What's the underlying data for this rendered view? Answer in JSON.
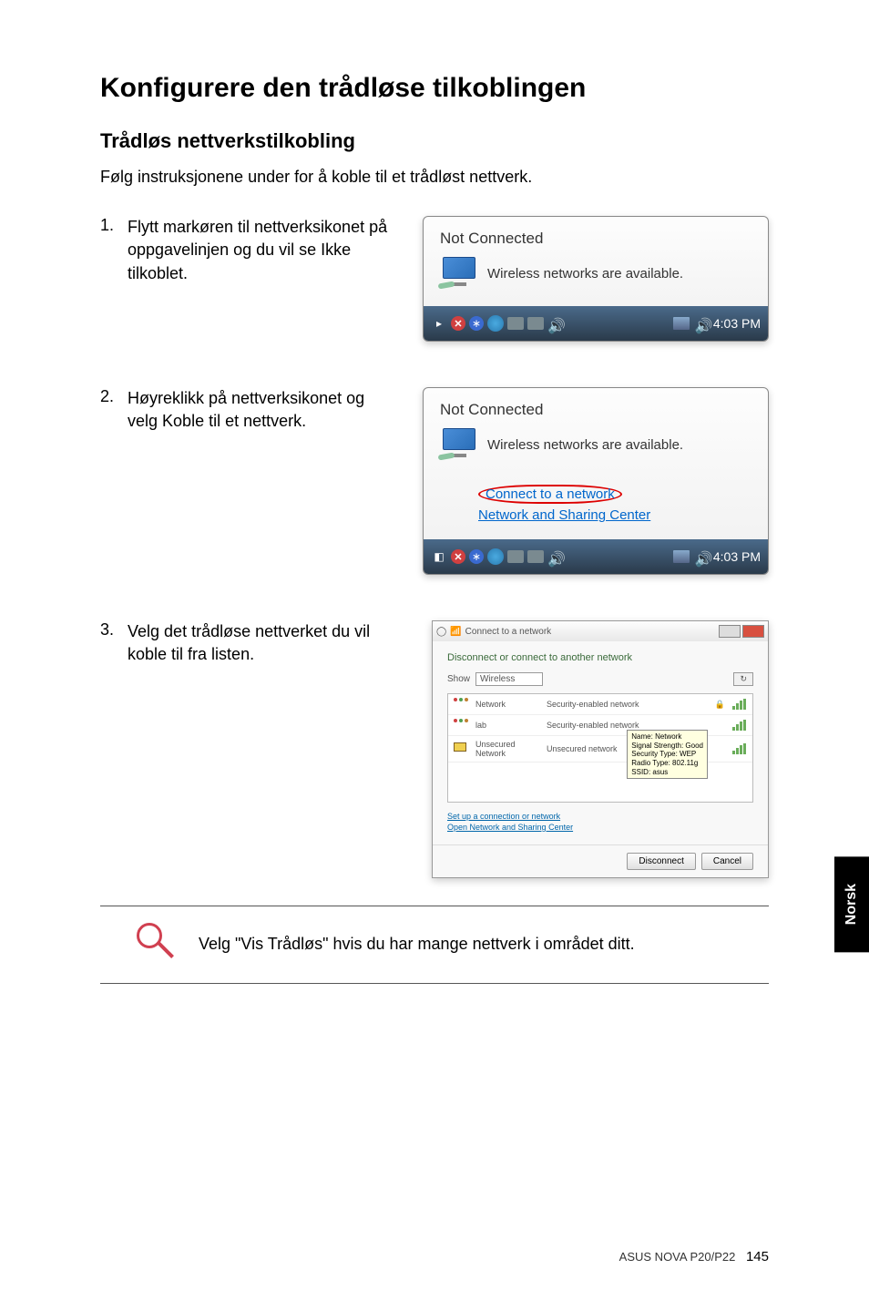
{
  "title": "Konfigurere den trådløse tilkoblingen",
  "subtitle": "Trådløs nettverkstilkobling",
  "intro": "Følg instruksjonene under for å koble til et trådløst nettverk.",
  "steps": [
    {
      "num": "1.",
      "text": "Flytt markøren til nettverksikonet på oppgavelinjen og du vil se Ikke tilkoblet."
    },
    {
      "num": "2.",
      "text": "Høyreklikk på nettverksikonet og velg Koble til et nettverk."
    },
    {
      "num": "3.",
      "text": "Velg det trådløse nettverket du vil koble til fra listen."
    }
  ],
  "popup": {
    "not_connected": "Not Connected",
    "wireless_msg": "Wireless networks are available.",
    "connect_link": "Connect to a network",
    "sharing_link": "Network and Sharing Center",
    "time": "4:03 PM"
  },
  "dialog": {
    "title": "Connect to a network",
    "heading": "Disconnect or connect to another network",
    "show_label": "Show",
    "show_value": "Wireless",
    "refresh": "↻",
    "networks": [
      {
        "name": "Network",
        "type": "Security-enabled network"
      },
      {
        "name": "lab",
        "type": "Security-enabled network"
      },
      {
        "name": "Unsecured Network",
        "type": "Unsecured network"
      }
    ],
    "tooltip": {
      "l1": "Name: Network",
      "l2": "Signal Strength: Good",
      "l3": "Security Type: WEP",
      "l4": "Radio Type: 802.11g",
      "l5": "SSID: asus"
    },
    "link1": "Set up a connection or network",
    "link2": "Open Network and Sharing Center",
    "btn_disconnect": "Disconnect",
    "btn_cancel": "Cancel"
  },
  "note": "Velg \"Vis Trådløs\" hvis du har mange nettverk i området ditt.",
  "side_tab": "Norsk",
  "footer_product": "ASUS NOVA P20/P22",
  "footer_page": "145"
}
